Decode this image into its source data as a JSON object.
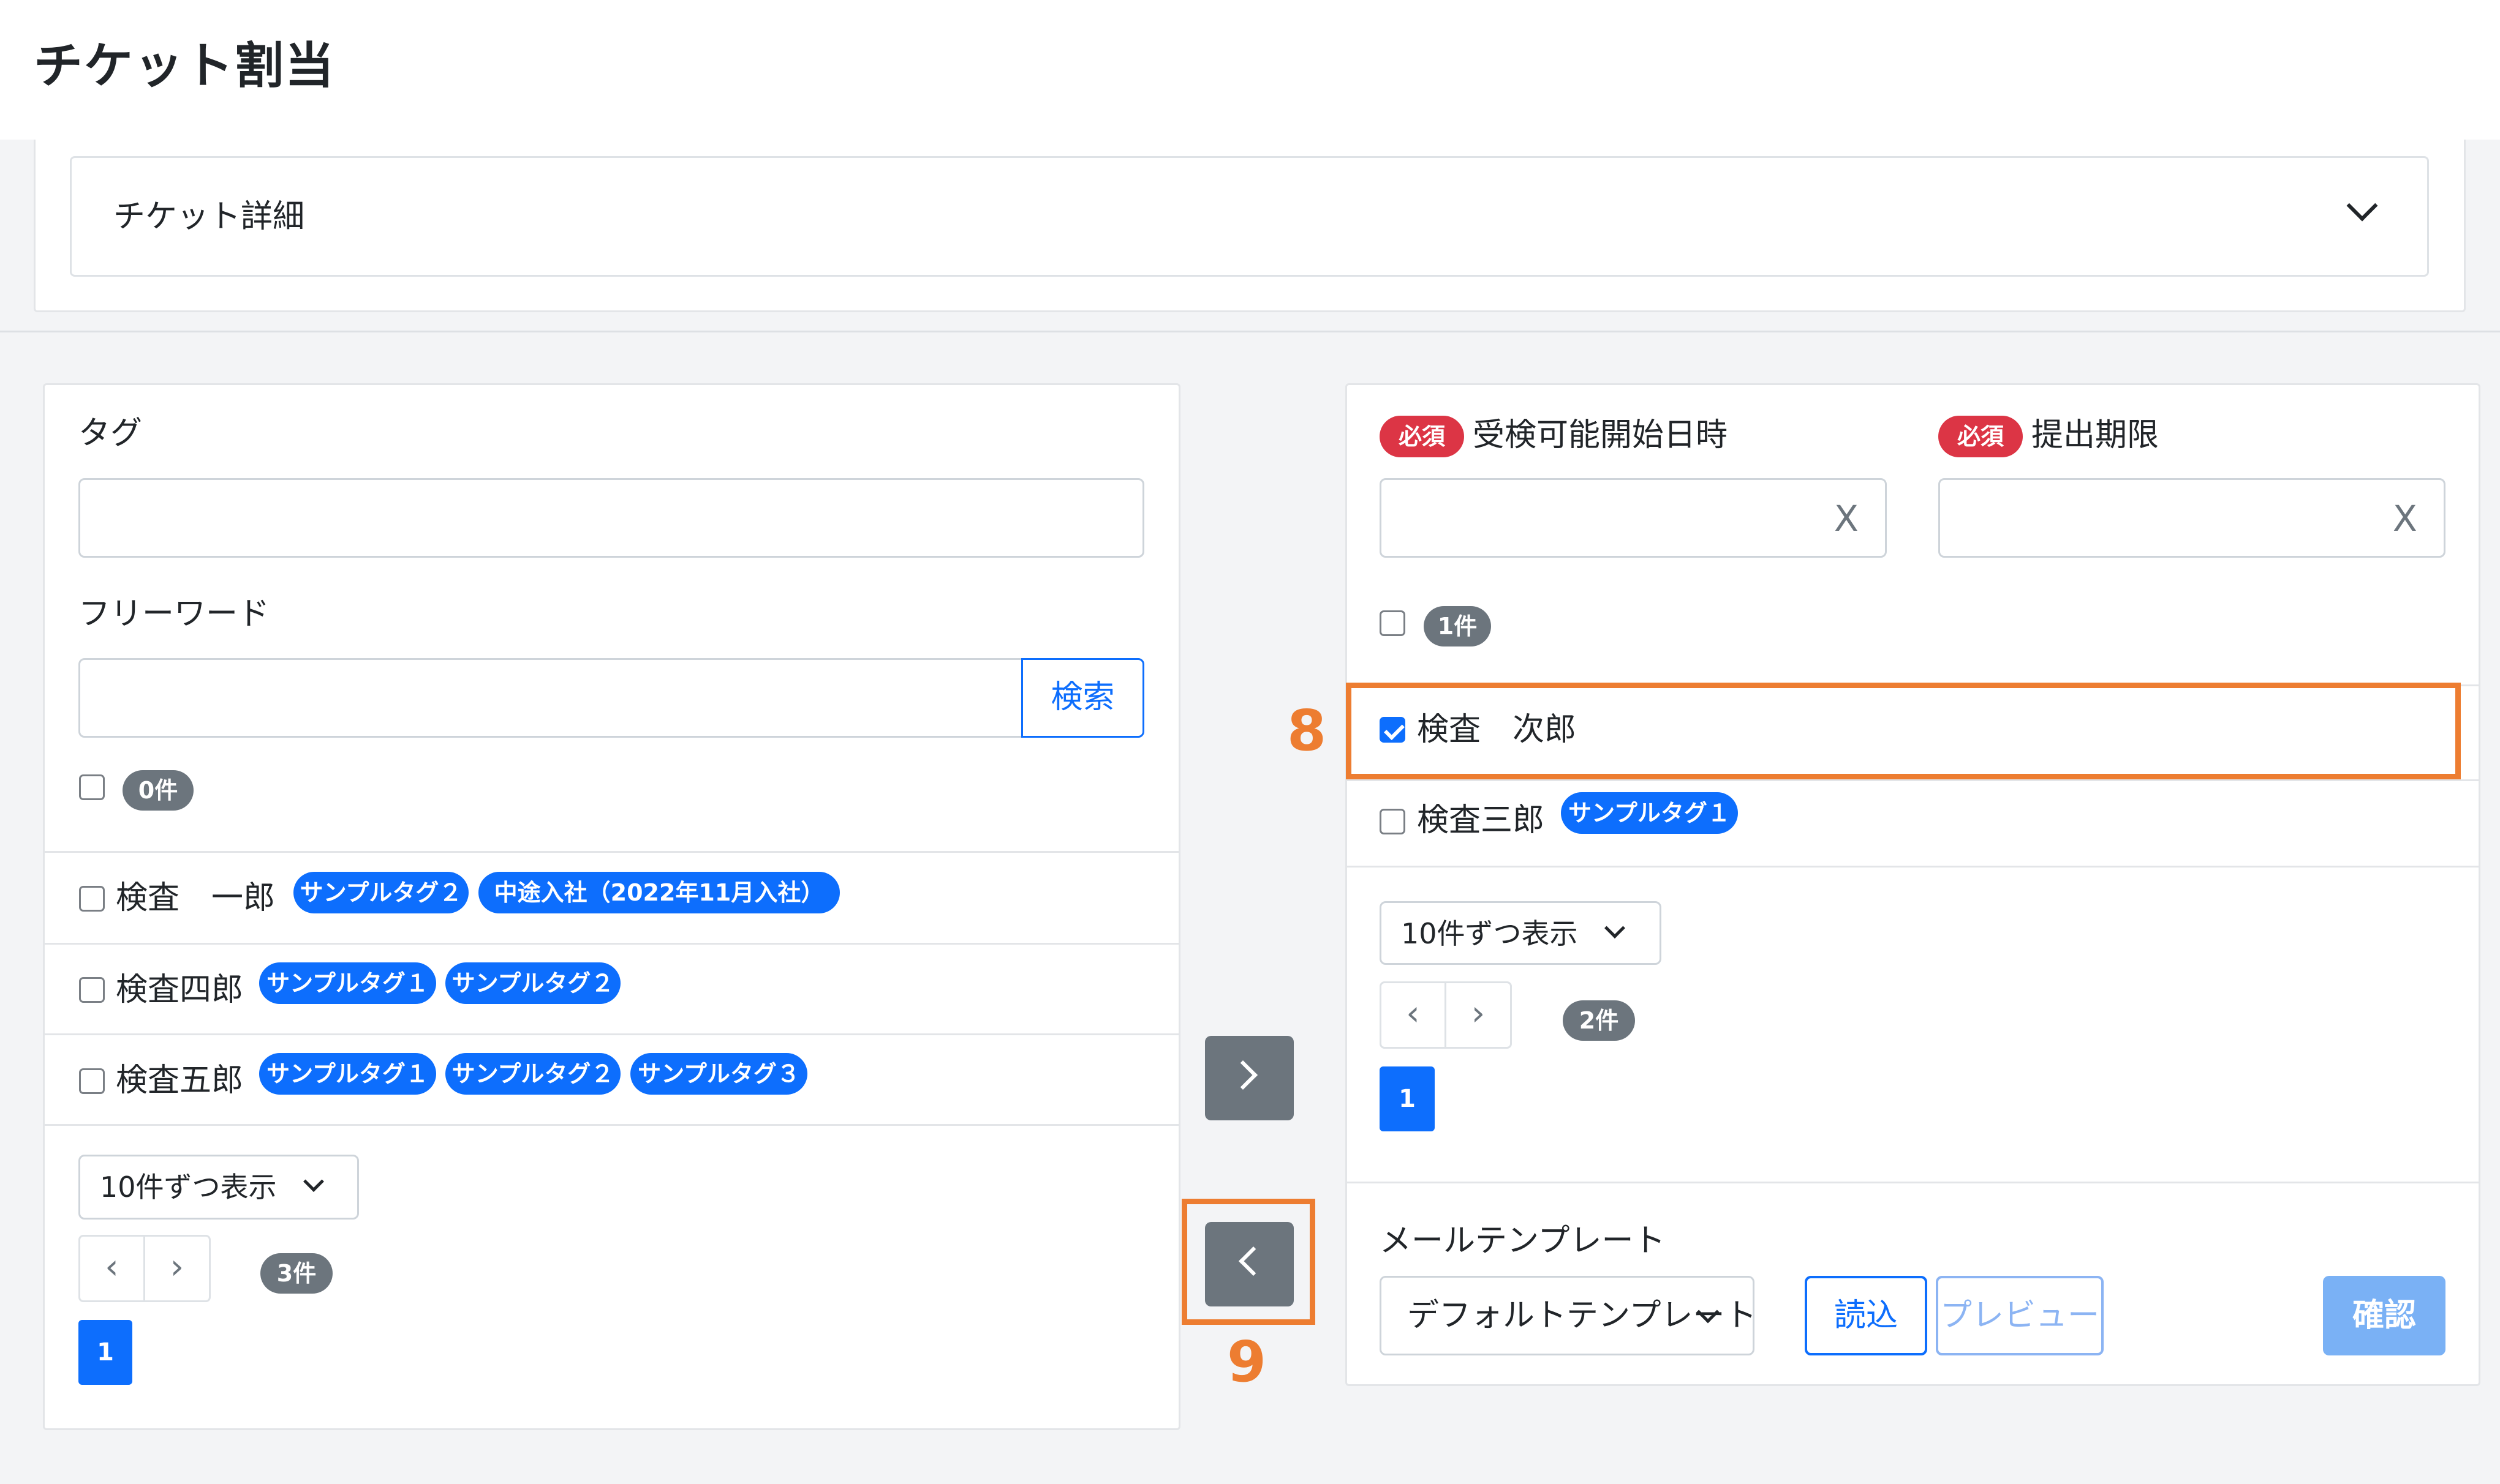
{
  "header": {
    "title": "チケット割当"
  },
  "ticket_detail": {
    "label": "チケット詳細",
    "icon": "chevron-down-icon"
  },
  "left_panel": {
    "tag_label": "タグ",
    "tag_value": "",
    "freeword_label": "フリーワード",
    "freeword_value": "",
    "search_button": "検索",
    "selected_count": "0件",
    "rows": [
      {
        "name": "検査　一郎",
        "checked": false,
        "tags": [
          "サンプルタグ２",
          "中途入社（2022年11月入社）"
        ]
      },
      {
        "name": "検査四郎",
        "checked": false,
        "tags": [
          "サンプルタグ１",
          "サンプルタグ２"
        ]
      },
      {
        "name": "検査五郎",
        "checked": false,
        "tags": [
          "サンプルタグ１",
          "サンプルタグ２",
          "サンプルタグ３"
        ]
      }
    ],
    "page_size": "10件ずつ表示",
    "total": "3件",
    "current_page": "1"
  },
  "transfer": {
    "move_right_icon": "chevron-right-icon",
    "move_left_icon": "chevron-left-icon"
  },
  "right_panel": {
    "required_badge": "必須",
    "start_label": "受検可能開始日時",
    "start_value": "",
    "deadline_label": "提出期限",
    "deadline_value": "",
    "clear_glyph": "X",
    "selected_count": "1件",
    "rows": [
      {
        "name": "検査　次郎",
        "checked": true,
        "tags": []
      },
      {
        "name": "検査三郎",
        "checked": false,
        "tags": [
          "サンプルタグ１"
        ]
      }
    ],
    "page_size": "10件ずつ表示",
    "total": "2件",
    "current_page": "1",
    "mail_template_label": "メールテンプレート",
    "mail_template_value": "デフォルトテンプレート",
    "load_button": "読込",
    "preview_button": "プレビュー",
    "confirm_button": "確認"
  },
  "annotations": {
    "marker_8": "8",
    "marker_9": "9",
    "color": "#ed7d31"
  },
  "colors": {
    "primary": "#0d6efd",
    "secondary": "#6c757d",
    "danger": "#dc3545"
  }
}
